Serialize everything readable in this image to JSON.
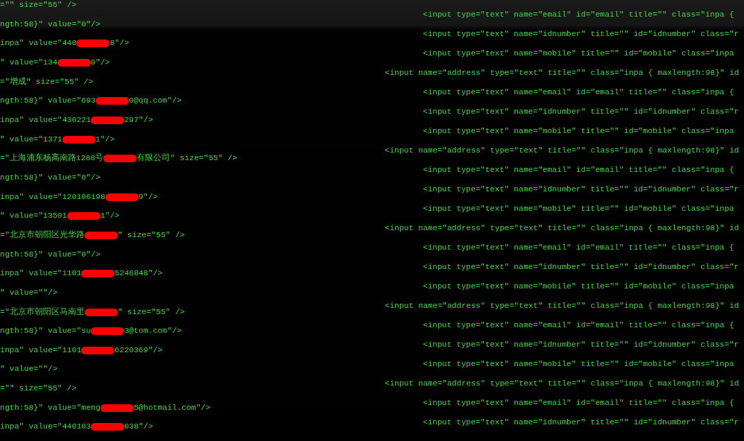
{
  "left_lines": [
    {
      "segments": [
        {
          "kind": "text",
          "text": "=\"\" size=\"55\" />"
        }
      ]
    },
    {
      "segments": [
        {
          "kind": "text",
          "text": "ngth:58}\" value=\"0\"/>"
        }
      ]
    },
    {
      "segments": [
        {
          "kind": "text",
          "text": "inpa\" value=\"440"
        },
        {
          "kind": "redaction"
        },
        {
          "kind": "text",
          "text": "8\"/>"
        }
      ]
    },
    {
      "segments": [
        {
          "kind": "text",
          "text": "\" value=\"134"
        },
        {
          "kind": "redaction"
        },
        {
          "kind": "text",
          "text": "0\"/>"
        }
      ]
    },
    {
      "segments": [
        {
          "kind": "text",
          "text": "=\"增成\" size=\"55\" />"
        }
      ]
    },
    {
      "segments": [
        {
          "kind": "text",
          "text": "ngth:58}\" value=\"693"
        },
        {
          "kind": "redaction"
        },
        {
          "kind": "text",
          "text": "0@qq.com\"/>"
        }
      ]
    },
    {
      "segments": [
        {
          "kind": "text",
          "text": "inpa\" value=\"430221"
        },
        {
          "kind": "redaction"
        },
        {
          "kind": "text",
          "text": "297\"/>"
        }
      ]
    },
    {
      "segments": [
        {
          "kind": "text",
          "text": "\" value=\"1371"
        },
        {
          "kind": "redaction"
        },
        {
          "kind": "text",
          "text": "1\"/>"
        }
      ]
    },
    {
      "segments": [
        {
          "kind": "text",
          "text": "=\"上海浦东杨高南路1288号"
        },
        {
          "kind": "redaction"
        },
        {
          "kind": "text",
          "text": "有限公司\" size=\"55\" />"
        }
      ]
    },
    {
      "segments": [
        {
          "kind": "text",
          "text": "ngth:58}\" value=\"0\"/>"
        }
      ]
    },
    {
      "segments": [
        {
          "kind": "text",
          "text": "inpa\" value=\"120106198"
        },
        {
          "kind": "redaction"
        },
        {
          "kind": "text",
          "text": "9\"/>"
        }
      ]
    },
    {
      "segments": [
        {
          "kind": "text",
          "text": "\" value=\"13501"
        },
        {
          "kind": "redaction"
        },
        {
          "kind": "text",
          "text": "1\"/>"
        }
      ]
    },
    {
      "segments": [
        {
          "kind": "text",
          "text": "=\"北京市朝阳区光华路"
        },
        {
          "kind": "redaction"
        },
        {
          "kind": "text",
          "text": "\" size=\"55\" />"
        }
      ]
    },
    {
      "segments": [
        {
          "kind": "text",
          "text": "ngth:58}\" value=\"0\"/>"
        }
      ]
    },
    {
      "segments": [
        {
          "kind": "text",
          "text": "inpa\" value=\"1101"
        },
        {
          "kind": "redaction"
        },
        {
          "kind": "text",
          "text": "5246848\"/>"
        }
      ]
    },
    {
      "segments": [
        {
          "kind": "text",
          "text": "\" value=\"\"/>"
        }
      ]
    },
    {
      "segments": [
        {
          "kind": "text",
          "text": "=\"北京市朝阳区马南里"
        },
        {
          "kind": "redaction"
        },
        {
          "kind": "text",
          "text": "\" size=\"55\" />"
        }
      ]
    },
    {
      "segments": [
        {
          "kind": "text",
          "text": "ngth:58}\" value=\"su"
        },
        {
          "kind": "redaction"
        },
        {
          "kind": "text",
          "text": "3@tom.com\"/>"
        }
      ]
    },
    {
      "segments": [
        {
          "kind": "text",
          "text": "inpa\" value=\"1101"
        },
        {
          "kind": "redaction"
        },
        {
          "kind": "text",
          "text": "6220369\"/>"
        }
      ]
    },
    {
      "segments": [
        {
          "kind": "text",
          "text": "\" value=\"\"/>"
        }
      ]
    },
    {
      "segments": [
        {
          "kind": "text",
          "text": "=\"\" size=\"55\" />"
        }
      ]
    },
    {
      "segments": [
        {
          "kind": "text",
          "text": "ngth:58}\" value=\"meng"
        },
        {
          "kind": "redaction"
        },
        {
          "kind": "text",
          "text": "5@hotmail.com\"/>"
        }
      ]
    },
    {
      "segments": [
        {
          "kind": "text",
          "text": "inpa\" value=\"440103"
        },
        {
          "kind": "redaction"
        },
        {
          "kind": "text",
          "text": "038\"/>"
        }
      ]
    }
  ],
  "right_lines": [
    {
      "kind": "indented",
      "text": "<input type=\"text\" name=\"email\" id=\"email\" title=\"\" class=\"inpa {"
    },
    {
      "kind": "indented",
      "text": "<input type=\"text\" name=\"idnumber\" title=\"\" id=\"idnumber\" class=\"r"
    },
    {
      "kind": "indented",
      "text": "<input type=\"text\" name=\"mobile\" title=\"\" id=\"mobile\" class=\"inpa"
    },
    {
      "kind": "flush",
      "text": "<input name=\"address\" type=\"text\" title=\"\" class=\"inpa { maxlength:98}\" id"
    },
    {
      "kind": "indented",
      "text": "<input type=\"text\" name=\"email\" id=\"email\" title=\"\" class=\"inpa {"
    },
    {
      "kind": "indented",
      "text": "<input type=\"text\" name=\"idnumber\" title=\"\" id=\"idnumber\" class=\"r"
    },
    {
      "kind": "indented",
      "text": "<input type=\"text\" name=\"mobile\" title=\"\" id=\"mobile\" class=\"inpa"
    },
    {
      "kind": "flush",
      "text": "<input name=\"address\" type=\"text\" title=\"\" class=\"inpa { maxlength:98}\" id"
    },
    {
      "kind": "indented",
      "text": "<input type=\"text\" name=\"email\" id=\"email\" title=\"\" class=\"inpa {"
    },
    {
      "kind": "indented",
      "text": "<input type=\"text\" name=\"idnumber\" title=\"\" id=\"idnumber\" class=\"r"
    },
    {
      "kind": "indented",
      "text": "<input type=\"text\" name=\"mobile\" title=\"\" id=\"mobile\" class=\"inpa"
    },
    {
      "kind": "flush",
      "text": "<input name=\"address\" type=\"text\" title=\"\" class=\"inpa { maxlength:98}\" id"
    },
    {
      "kind": "indented",
      "text": "<input type=\"text\" name=\"email\" id=\"email\" title=\"\" class=\"inpa {"
    },
    {
      "kind": "indented",
      "text": "<input type=\"text\" name=\"idnumber\" title=\"\" id=\"idnumber\" class=\"r"
    },
    {
      "kind": "indented",
      "text": "<input type=\"text\" name=\"mobile\" title=\"\" id=\"mobile\" class=\"inpa"
    },
    {
      "kind": "flush",
      "text": "<input name=\"address\" type=\"text\" title=\"\" class=\"inpa { maxlength:98}\" id"
    },
    {
      "kind": "indented",
      "text": "<input type=\"text\" name=\"email\" id=\"email\" title=\"\" class=\"inpa {"
    },
    {
      "kind": "indented",
      "text": "<input type=\"text\" name=\"idnumber\" title=\"\" id=\"idnumber\" class=\"r"
    },
    {
      "kind": "indented",
      "text": "<input type=\"text\" name=\"mobile\" title=\"\" id=\"mobile\" class=\"inpa"
    },
    {
      "kind": "flush",
      "text": "<input name=\"address\" type=\"text\" title=\"\" class=\"inpa { maxlength:98}\" id"
    },
    {
      "kind": "indented",
      "text": "<input type=\"text\" name=\"email\" id=\"email\" title=\"\" class=\"inpa {"
    },
    {
      "kind": "indented",
      "text": "<input type=\"text\" name=\"idnumber\" title=\"\" id=\"idnumber\" class=\"r"
    }
  ]
}
